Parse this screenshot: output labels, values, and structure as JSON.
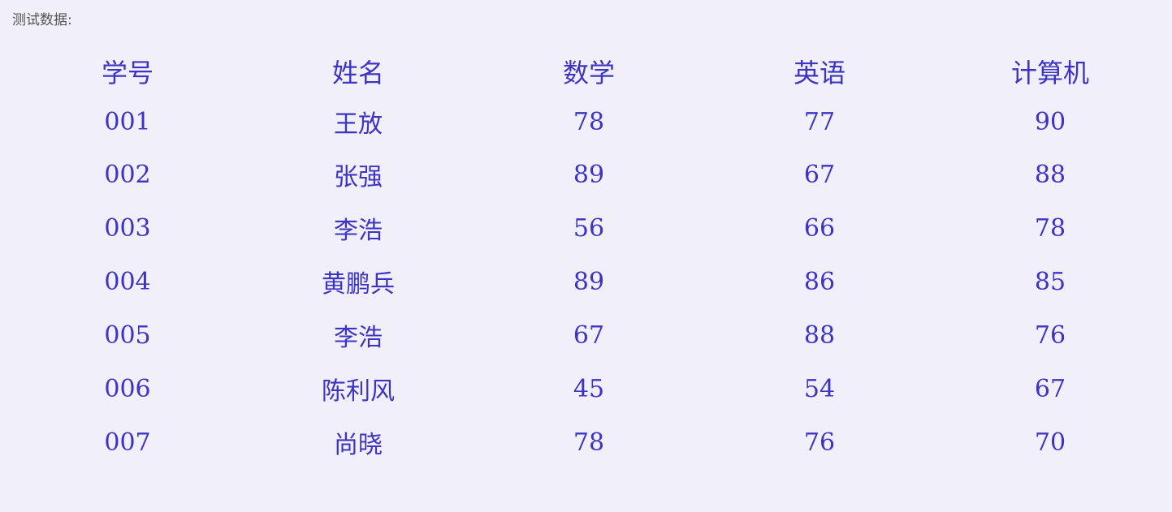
{
  "label": "测试数据:",
  "table": {
    "headers": [
      "学号",
      "姓名",
      "数学",
      "英语",
      "计算机"
    ],
    "rows": [
      [
        "001",
        "王放",
        "78",
        "77",
        "90"
      ],
      [
        "002",
        "张强",
        "89",
        "67",
        "88"
      ],
      [
        "003",
        "李浩",
        "56",
        "66",
        "78"
      ],
      [
        "004",
        "黄鹏兵",
        "89",
        "86",
        "85"
      ],
      [
        "005",
        "李浩",
        "67",
        "88",
        "76"
      ],
      [
        "006",
        "陈利风",
        "45",
        "54",
        "67"
      ],
      [
        "007",
        "尚晓",
        "78",
        "76",
        "70"
      ]
    ]
  },
  "colors": {
    "background": "#f1eff9",
    "table_text": "#3d34c4",
    "label_text": "#555555"
  }
}
